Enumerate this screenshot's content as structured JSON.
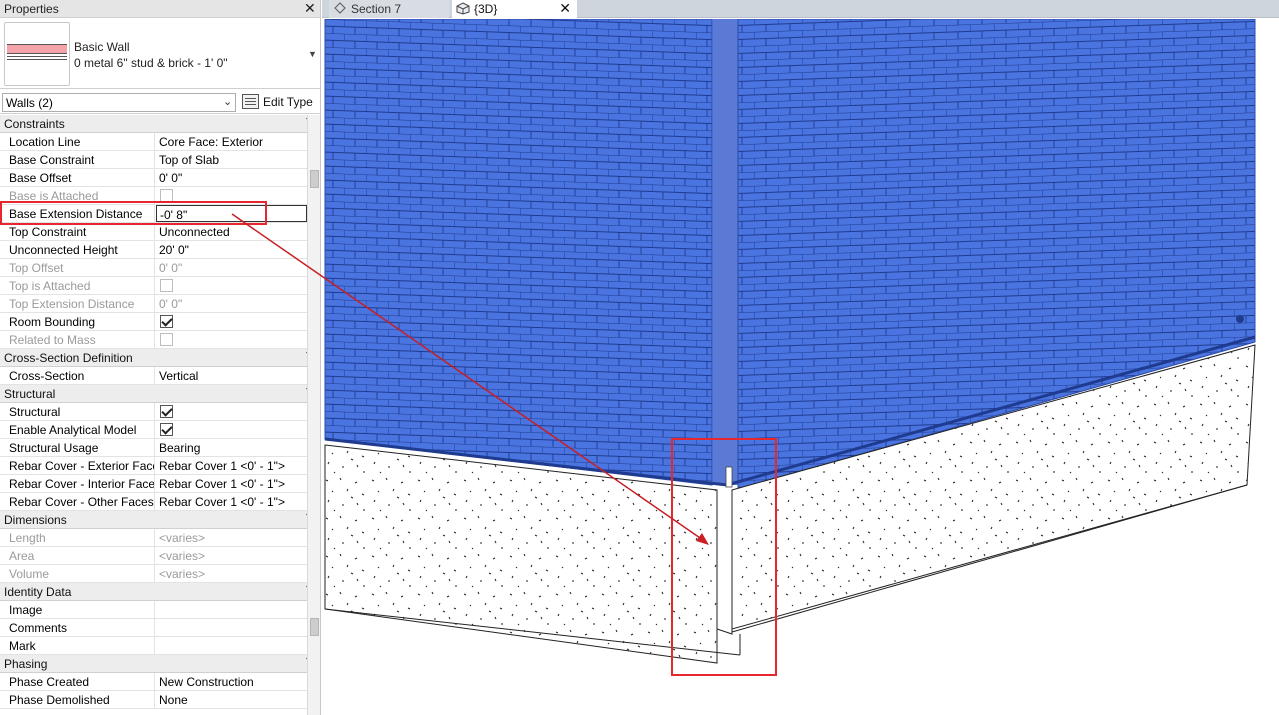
{
  "properties": {
    "title": "Properties",
    "close": "✕",
    "type_family": "Basic Wall",
    "type_name": "0 metal 6\" stud & brick - 1' 0\"",
    "instance_selector": "Walls (2)",
    "edit_type": "Edit Type",
    "sections": [
      {
        "name": "Constraints",
        "rows": [
          {
            "label": "Location Line",
            "value": "Core Face: Exterior"
          },
          {
            "label": "Base Constraint",
            "value": "Top of Slab"
          },
          {
            "label": "Base Offset",
            "value": "0'  0\""
          },
          {
            "label": "Base is Attached",
            "value": ""
          },
          {
            "label": "Base Extension Distance",
            "value": "-0'  8\""
          },
          {
            "label": "Top Constraint",
            "value": "Unconnected"
          },
          {
            "label": "Unconnected Height",
            "value": "20'  0\""
          },
          {
            "label": "Top Offset",
            "value": "0'  0\""
          },
          {
            "label": "Top is Attached",
            "value": ""
          },
          {
            "label": "Top Extension Distance",
            "value": "0'  0\""
          },
          {
            "label": "Room Bounding",
            "value": ""
          },
          {
            "label": "Related to Mass",
            "value": ""
          }
        ]
      },
      {
        "name": "Cross-Section Definition",
        "rows": [
          {
            "label": "Cross-Section",
            "value": "Vertical"
          }
        ]
      },
      {
        "name": "Structural",
        "rows": [
          {
            "label": "Structural",
            "value": ""
          },
          {
            "label": "Enable Analytical Model",
            "value": ""
          },
          {
            "label": "Structural Usage",
            "value": "Bearing"
          },
          {
            "label": "Rebar Cover - Exterior Face",
            "value": "Rebar Cover 1 <0' - 1\">"
          },
          {
            "label": "Rebar Cover - Interior Face",
            "value": "Rebar Cover 1 <0' - 1\">"
          },
          {
            "label": "Rebar Cover - Other Faces",
            "value": "Rebar Cover 1 <0' - 1\">"
          }
        ]
      },
      {
        "name": "Dimensions",
        "rows": [
          {
            "label": "Length",
            "value": "<varies>"
          },
          {
            "label": "Area",
            "value": "<varies>"
          },
          {
            "label": "Volume",
            "value": "<varies>"
          }
        ]
      },
      {
        "name": "Identity Data",
        "rows": [
          {
            "label": "Image",
            "value": ""
          },
          {
            "label": "Comments",
            "value": ""
          },
          {
            "label": "Mark",
            "value": ""
          }
        ]
      },
      {
        "name": "Phasing",
        "rows": [
          {
            "label": "Phase Created",
            "value": "New Construction"
          },
          {
            "label": "Phase Demolished",
            "value": "None"
          }
        ]
      }
    ]
  },
  "tabs": [
    {
      "label": "Section 7",
      "icon": "section-view-icon"
    },
    {
      "label": "{3D}",
      "icon": "3d-view-icon",
      "close": "✕"
    }
  ],
  "colors": {
    "highlight": "#e8262e",
    "arrow": "#c81e24",
    "brick": "#4a74e0",
    "brick_dark": "#3a5fc4",
    "mortar": "#1f3b8f",
    "concrete": "#ffffff"
  }
}
